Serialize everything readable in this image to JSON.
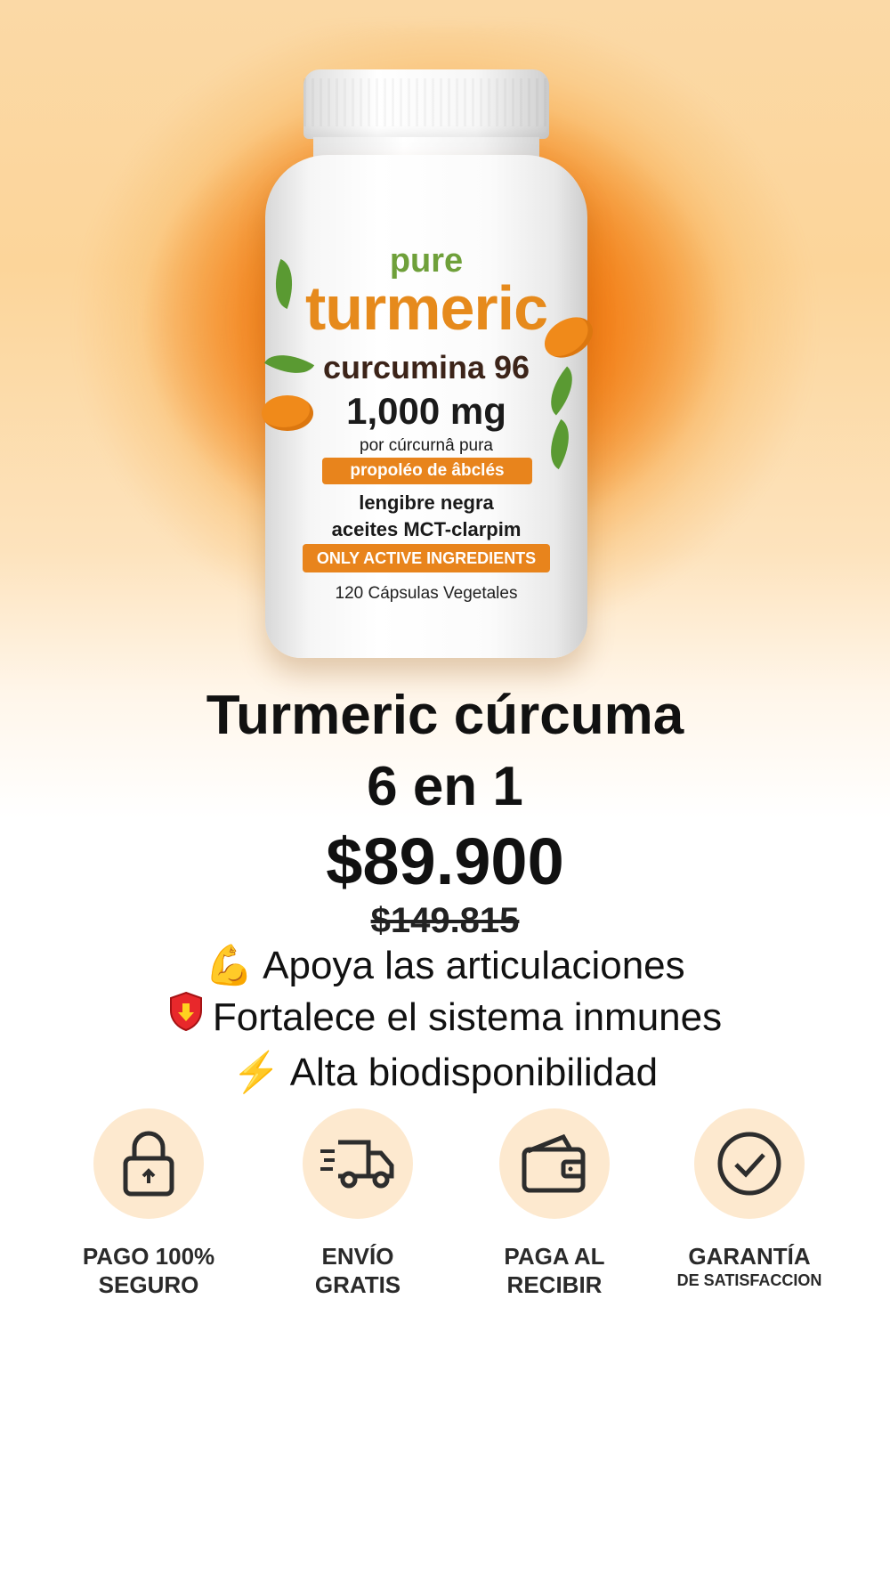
{
  "bottle": {
    "pure": "pure",
    "brand": "turmeric",
    "curcumina": "curcumina 96",
    "dose": "1,000 mg",
    "per": "por cúrcurnâ pura",
    "tag1": "propoléo de âbclés",
    "ingredient1": "lengibre negra",
    "ingredient2": "aceites MCT-clarpim",
    "tag2": "ONLY ACTIVE INGREDIENTS",
    "capsules": "120 Cápsulas Vegetales"
  },
  "product": {
    "title_line1": "Turmeric cúrcuma",
    "title_line2": "6 en 1",
    "price": "$89.900",
    "old_price": "$149.815"
  },
  "benefits": [
    {
      "icon": "💪",
      "icon_name": "flexed-biceps-icon",
      "text": "Apoya las articulaciones"
    },
    {
      "icon": "🛡",
      "icon_name": "shield-icon",
      "text": "Fortalece el sistema inmunes"
    },
    {
      "icon": "⚡",
      "icon_name": "lightning-icon",
      "text": "Alta biodisponibilidad"
    }
  ],
  "badges": [
    {
      "icon_name": "lock-icon",
      "line1": "PAGO 100%",
      "line2": "SEGURO"
    },
    {
      "icon_name": "delivery-truck-icon",
      "line1": "ENVÍO",
      "line2": "GRATIS"
    },
    {
      "icon_name": "wallet-icon",
      "line1": "PAGA AL",
      "line2": "RECIBIR"
    },
    {
      "icon_name": "checkmark-circle-icon",
      "line1": "GARANTÍA",
      "line2": "DE SATISFACCION"
    }
  ],
  "colors": {
    "accent_orange": "#e8841c",
    "brand_green": "#6fa03a",
    "badge_circle": "#fde9cf"
  }
}
